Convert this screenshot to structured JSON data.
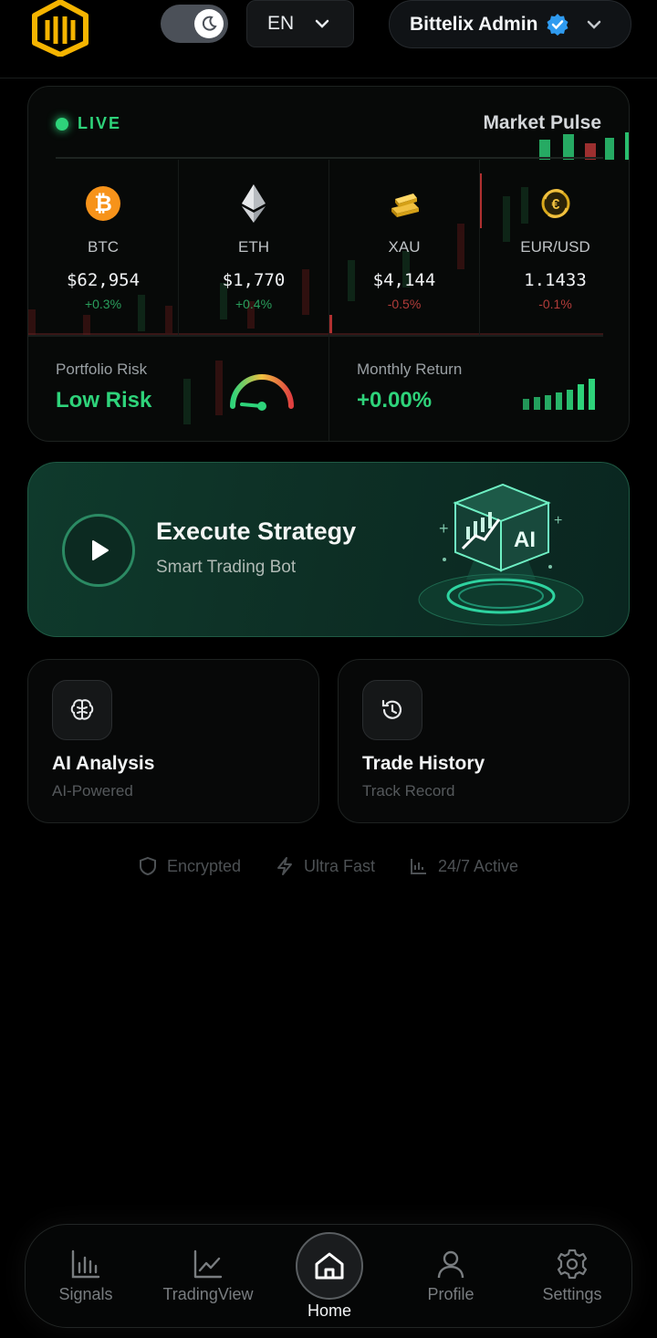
{
  "header": {
    "language": "EN",
    "account_name": "Bittelix Admin",
    "theme": "dark"
  },
  "market": {
    "live_label": "LIVE",
    "title": "Market Pulse",
    "assets": [
      {
        "symbol": "BTC",
        "price": "$62,954",
        "change": "+0.3%",
        "direction": "up",
        "icon": "bitcoin-icon"
      },
      {
        "symbol": "ETH",
        "price": "$1,770",
        "change": "+0.4%",
        "direction": "up",
        "icon": "ethereum-icon"
      },
      {
        "symbol": "XAU",
        "price": "$4,144",
        "change": "-0.5%",
        "direction": "down",
        "icon": "gold-bar-icon"
      },
      {
        "symbol": "EUR/USD",
        "price": "1.1433",
        "change": "-0.1%",
        "direction": "down",
        "icon": "currency-exchange-icon"
      }
    ],
    "portfolio_risk": {
      "label": "Portfolio Risk",
      "value": "Low Risk"
    },
    "monthly_return": {
      "label": "Monthly Return",
      "value": "+0.00%"
    }
  },
  "execute": {
    "title": "Execute Strategy",
    "subtitle": "Smart Trading Bot",
    "art_label": "AI"
  },
  "features": [
    {
      "title": "AI Analysis",
      "subtitle": "AI-Powered",
      "icon": "brain-icon"
    },
    {
      "title": "Trade History",
      "subtitle": "Track Record",
      "icon": "history-icon"
    }
  ],
  "badges": [
    {
      "label": "Encrypted",
      "icon": "shield-icon"
    },
    {
      "label": "Ultra Fast",
      "icon": "lightning-icon"
    },
    {
      "label": "24/7 Active",
      "icon": "bar-chart-icon"
    }
  ],
  "nav": {
    "items": [
      {
        "label": "Signals",
        "icon": "signals-icon"
      },
      {
        "label": "TradingView",
        "icon": "line-chart-icon"
      },
      {
        "label": "Home",
        "icon": "home-icon",
        "active": true
      },
      {
        "label": "Profile",
        "icon": "user-icon"
      },
      {
        "label": "Settings",
        "icon": "gear-icon"
      }
    ]
  },
  "colors": {
    "accent_green": "#2ed37a",
    "negative_red": "#b23c3a",
    "brand_gold": "#f5b400",
    "verified_blue": "#2f9bf0"
  }
}
